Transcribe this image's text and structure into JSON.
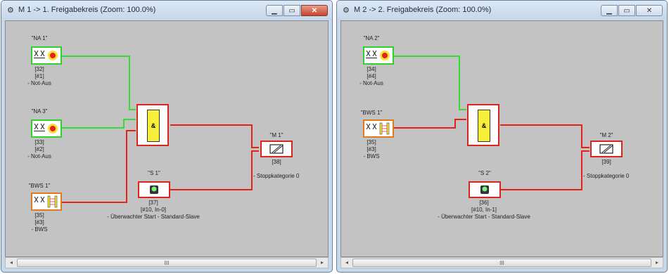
{
  "windows": [
    {
      "title": "M 1  ->  1. Freigabekreis (Zoom: 100.0%)",
      "close_hover": true,
      "blocks": {
        "na1": {
          "name": "\"NA 1\"",
          "info": "[32]\n[#1]\n- Not-Aus"
        },
        "na3": {
          "name": "\"NA 3\"",
          "info": "[33]\n[#2]\n- Not-Aus"
        },
        "bws1": {
          "name": "\"BWS 1\"",
          "info": "[35]\n[#3]\n- BWS"
        },
        "s1": {
          "name": "\"S 1\"",
          "info": "[37]\n[#10, In-0]\n- Überwachter Start - Standard-Slave"
        },
        "m1": {
          "name": "\"M 1\"",
          "info": "[38]",
          "extra": "- Stoppkategorie 0"
        },
        "and": {
          "symbol": "&"
        }
      }
    },
    {
      "title": "M 2  ->  2. Freigabekreis (Zoom: 100.0%)",
      "close_hover": false,
      "blocks": {
        "na2": {
          "name": "\"NA 2\"",
          "info": "[34]\n[#4]\n- Not-Aus"
        },
        "bws1": {
          "name": "\"BWS 1\"",
          "info": "[35]\n[#3]\n- BWS"
        },
        "s2": {
          "name": "\"S 2\"",
          "info": "[36]\n[#10, In-1]\n- Überwachter Start - Standard-Slave"
        },
        "m2": {
          "name": "\"M 2\"",
          "info": "[39]",
          "extra": "- Stoppkategorie 0"
        },
        "and": {
          "symbol": "&"
        }
      }
    }
  ],
  "icons": {
    "window": "gear-icon",
    "minimize": "minimize-icon",
    "maximize": "maximize-icon",
    "close": "close-icon",
    "estop": "emergency-stop-icon",
    "curtain": "light-curtain-icon",
    "relay": "relay-output-icon",
    "start": "start-button-icon"
  },
  "scrollbar": {
    "left": "◂",
    "right": "▸",
    "thumb": "III"
  },
  "colors": {
    "safe": "#33dd33",
    "unsafe": "#e8201a",
    "canvas": "#c3c3c3",
    "sensor_orange": "#e07a1c"
  }
}
